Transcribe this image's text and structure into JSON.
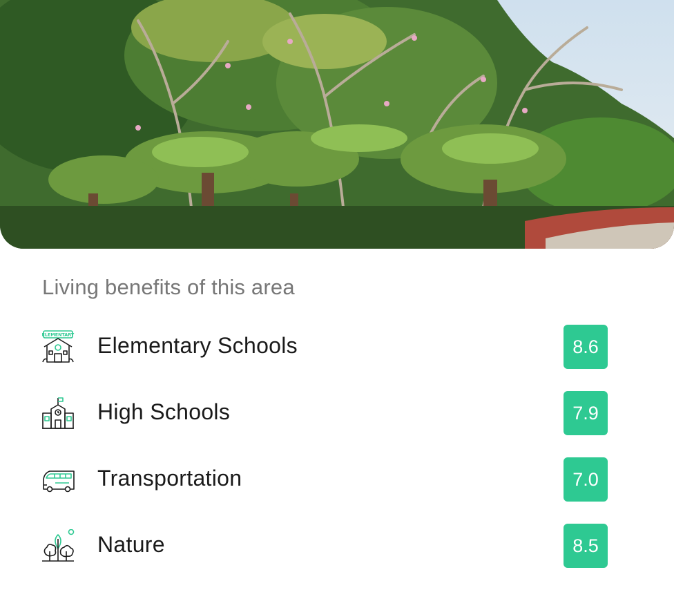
{
  "hero": {
    "image": "garden-palms-photo"
  },
  "section": {
    "title": "Living benefits of this area"
  },
  "benefits": [
    {
      "label": "Elementary Schools",
      "score": "8.6",
      "icon": "elementary-school-icon",
      "icon_text": "ELEMENTARY"
    },
    {
      "label": "High Schools",
      "score": "7.9",
      "icon": "high-school-icon"
    },
    {
      "label": "Transportation",
      "score": "7.0",
      "icon": "bus-icon"
    },
    {
      "label": "Nature",
      "score": "8.5",
      "icon": "trees-icon"
    }
  ],
  "colors": {
    "accent": "#2ec992",
    "title": "#777777",
    "text": "#1a1a1a"
  }
}
